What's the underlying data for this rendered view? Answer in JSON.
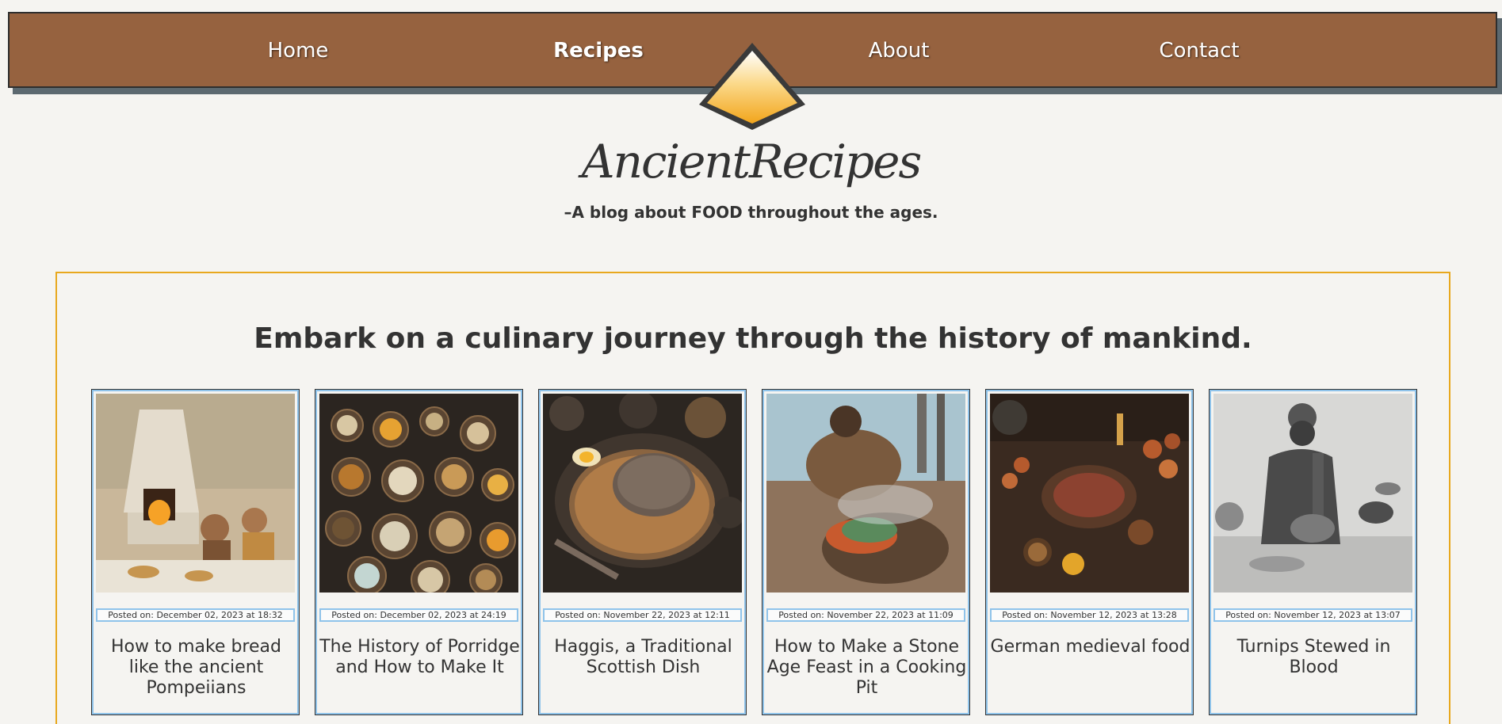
{
  "nav": {
    "items": [
      {
        "label": "Home"
      },
      {
        "label": "Recipes",
        "active": true
      },
      {
        "label": "About"
      },
      {
        "label": "Contact"
      }
    ]
  },
  "brand": {
    "name": "AncientRecipes",
    "tagline": "–A blog about FOOD throughout the ages."
  },
  "main": {
    "headline": "Embark on a culinary journey through the history of mankind."
  },
  "posts": [
    {
      "date": "Posted on: December 02, 2023 at 18:32",
      "title": "How to make bread like the ancient Pompeiians"
    },
    {
      "date": "Posted on: December 02, 2023 at 24:19",
      "title": "The History of Porridge and How to Make It"
    },
    {
      "date": "Posted on: November 22, 2023 at 12:11",
      "title": "Haggis, a Traditional Scottish Dish"
    },
    {
      "date": "Posted on: November 22, 2023 at 11:09",
      "title": "How to Make a Stone Age Feast in a Cooking Pit"
    },
    {
      "date": "Posted on: November 12, 2023 at 13:28",
      "title": "German medieval food"
    },
    {
      "date": "Posted on: November 12, 2023 at 13:07",
      "title": "Turnips Stewed in Blood"
    }
  ],
  "colors": {
    "nav_bg": "#96623f",
    "accent": "#e8a81e",
    "card_border": "#8fc3ea",
    "page_bg": "#f5f4f1"
  }
}
